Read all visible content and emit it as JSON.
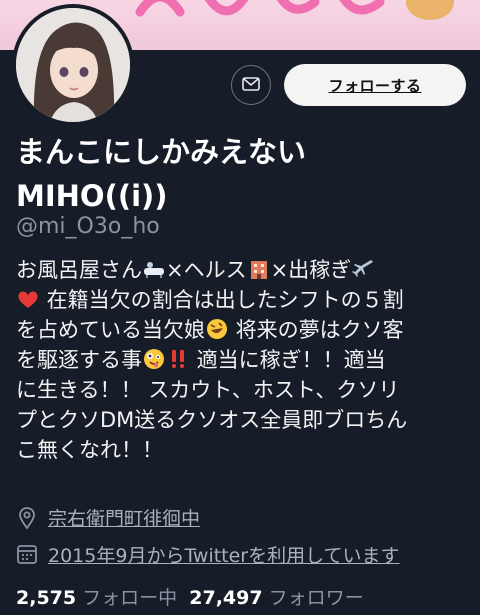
{
  "profile": {
    "name_line1": "まんこにしかみえない",
    "name_line2": "MIHO((i))",
    "handle": "@mi_O3o_ho",
    "follow_label": "フォローする",
    "bio": {
      "l1a": "お風呂屋さん",
      "l1b": "×ヘルス",
      "l1c": "×出稼ぎ",
      "l2": " 在籍当欠の割合は出したシフトの５割",
      "l3a": "を占めている当欠娘",
      "l3b": " 将来の夢はクソ客",
      "l4a": "を駆逐する事",
      "l4b": " 適当に稼ぎ！！適当",
      "l5": "に生きる！！ スカウト、ホスト、クソリ",
      "l6": "プとクソDM送るクソオス全員即ブロちん",
      "l7": "こ無くなれ！！"
    },
    "location": "宗右衛門町徘徊中",
    "joined": "2015年9月からTwitterを利用しています",
    "following_count": "2,575",
    "following_label": "フォロー中",
    "followers_count": "27,497",
    "followers_label": "フォロワー"
  },
  "icons": {
    "mail": "envelope-icon",
    "location": "location-pin-icon",
    "calendar": "calendar-icon"
  },
  "colors": {
    "background": "#161c28",
    "muted": "#8b94a3",
    "button_bg": "#f4f4f2"
  }
}
